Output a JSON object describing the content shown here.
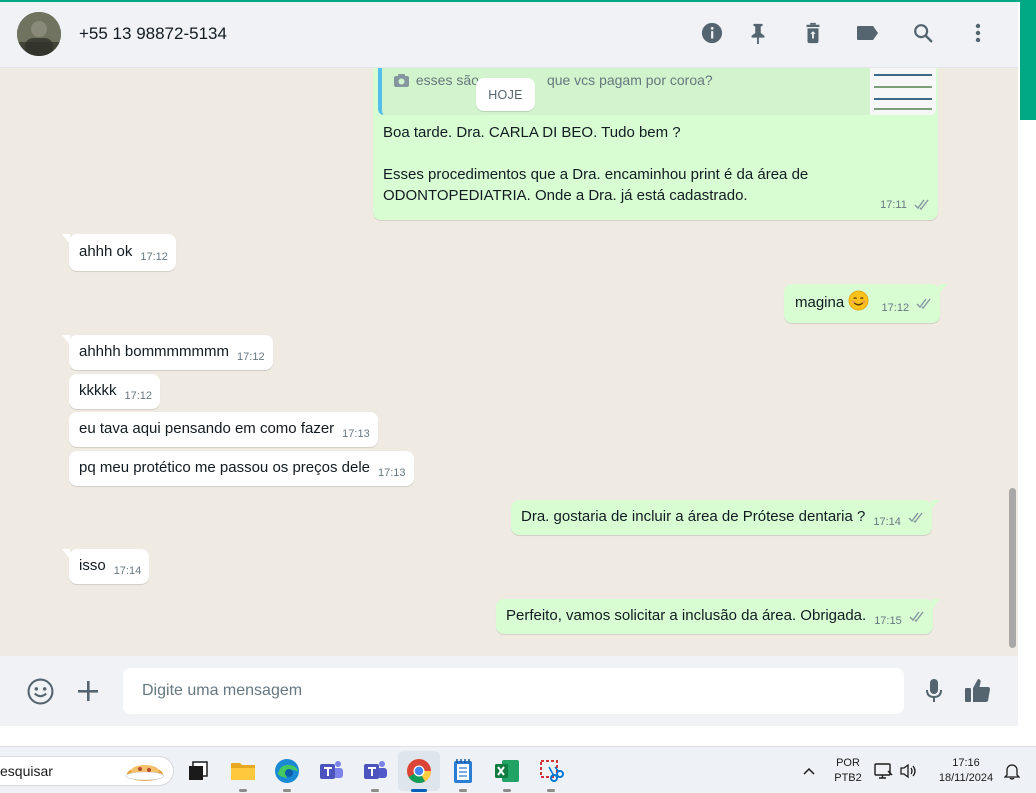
{
  "header": {
    "contact_name": "+55 13 98872-5134",
    "icons": [
      "info-icon",
      "pin-icon",
      "delete-icon",
      "label-icon",
      "search-icon",
      "menu-icon"
    ]
  },
  "colors": {
    "accent": "#00a884",
    "incoming_bubble": "#ffffff",
    "outgoing_bubble": "#d9fdd3",
    "chat_bg": "#efeae2",
    "read_ticks": "#8696a0"
  },
  "chat": {
    "date_pill": "HOJE",
    "quoted": {
      "text_before": "esses são",
      "text_after": "que vcs pagam por coroa?",
      "thumb_lines": [
        "foto inicial na solicitação",
        "foto inicial na solicitação",
        "finalizar na solicitação",
        "foto inicial na solicitação"
      ]
    },
    "messages": [
      {
        "dir": "out",
        "lines": [
          "Boa tarde. Dra. CARLA DI BEO. Tudo bem ?",
          "",
          "Esses procedimentos que a Dra. encaminhou print é da área de",
          "ODONTOPEDIATRIA. Onde a Dra. já está cadastrado."
        ],
        "time": "17:11"
      },
      {
        "dir": "in",
        "text": "ahhh ok",
        "time": "17:12"
      },
      {
        "dir": "out",
        "text": "magina",
        "emoji": "☺️",
        "time": "17:12"
      },
      {
        "dir": "in",
        "text": "ahhhh bommmmmmm",
        "time": "17:12"
      },
      {
        "dir": "in",
        "text": "kkkkk",
        "time": "17:12"
      },
      {
        "dir": "in",
        "text": "eu tava aqui pensando em como fazer",
        "time": "17:13"
      },
      {
        "dir": "in",
        "text": "pq meu protético me passou os preços dele",
        "time": "17:13"
      },
      {
        "dir": "out",
        "text": "Dra. gostaria de incluir a área de Prótese dentaria ?",
        "time": "17:14"
      },
      {
        "dir": "in",
        "text": "isso",
        "time": "17:14"
      },
      {
        "dir": "out",
        "text": "Perfeito, vamos solicitar a inclusão da área. Obrigada.",
        "time": "17:15"
      }
    ]
  },
  "composer": {
    "placeholder": "Digite uma mensagem",
    "icons": [
      "emoji-icon",
      "attach-plus-icon",
      "microphone-icon",
      "thumbs-up-icon"
    ]
  },
  "taskbar": {
    "search_text": "esquisar",
    "apps": [
      "task-view",
      "file-explorer",
      "edge",
      "teams-classic",
      "teams",
      "chrome",
      "notepad",
      "excel",
      "snipping-tool"
    ],
    "language": "POR",
    "keyboard": "PTB2",
    "time": "17:16",
    "date": "18/11/2024"
  }
}
